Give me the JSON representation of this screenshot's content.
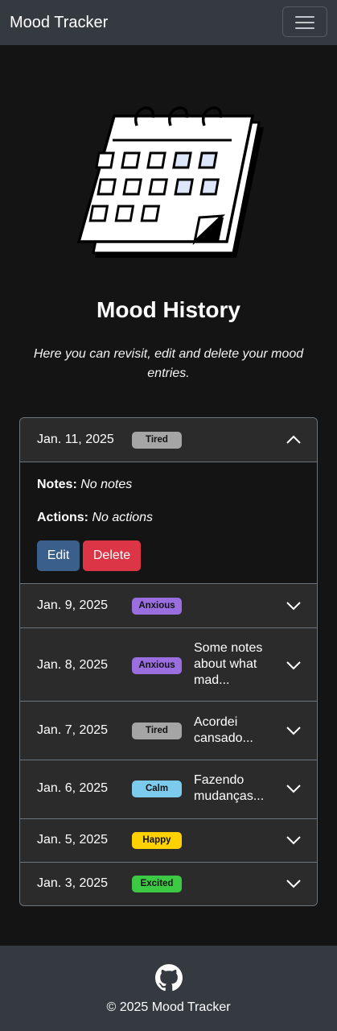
{
  "navbar": {
    "brand": "Mood Tracker",
    "toggler_icon": "hamburger-icon"
  },
  "hero": {
    "illustration": "calendar-illustration"
  },
  "page": {
    "title": "Mood History",
    "subtitle": "Here you can revisit, edit and delete your mood entries."
  },
  "colors": {
    "navbar_bg": "#343a40",
    "page_bg": "#141414",
    "edit_button": "#3a5f8a",
    "delete_button": "#dc3545",
    "tired": "#a5a5a5",
    "anxious": "#9b6ee0",
    "calm": "#7ccbed",
    "happy": "#ffd100",
    "excited": "#3cc944"
  },
  "entries": [
    {
      "date": "Jan. 11, 2025",
      "mood": "Tired",
      "note": "",
      "expanded": true
    },
    {
      "date": "Jan. 9, 2025",
      "mood": "Anxious",
      "note": "",
      "expanded": false
    },
    {
      "date": "Jan. 8, 2025",
      "mood": "Anxious",
      "note": "Some notes about what mad...",
      "expanded": false
    },
    {
      "date": "Jan. 7, 2025",
      "mood": "Tired",
      "note": "Acordei cansado...",
      "expanded": false
    },
    {
      "date": "Jan. 6, 2025",
      "mood": "Calm",
      "note": "Fazendo mudanças...",
      "expanded": false
    },
    {
      "date": "Jan. 5, 2025",
      "mood": "Happy",
      "note": "",
      "expanded": false
    },
    {
      "date": "Jan. 3, 2025",
      "mood": "Excited",
      "note": "",
      "expanded": false
    }
  ],
  "expanded_entry": {
    "notes_label": "Notes:",
    "notes_value": "No notes",
    "actions_label": "Actions:",
    "actions_value": "No actions",
    "edit_label": "Edit",
    "delete_label": "Delete"
  },
  "footer": {
    "icon": "github-icon",
    "copyright": "© 2025 Mood Tracker"
  }
}
